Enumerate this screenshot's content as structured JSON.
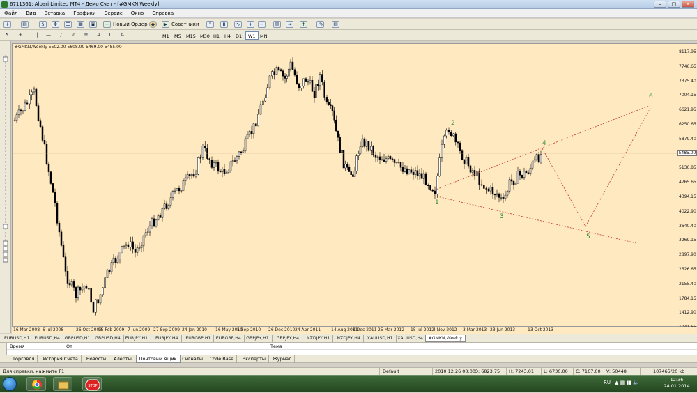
{
  "window": {
    "title": "6711361: Alpari Limited MT4 - Демо Счет - [#GMKN,Weekly]",
    "buttons": [
      "–",
      "□",
      "✕"
    ]
  },
  "menu": [
    "Файл",
    "Вид",
    "Вставка",
    "Графики",
    "Сервис",
    "Окно",
    "Справка"
  ],
  "toolbar": {
    "new_order": "Новый Ордер",
    "experts": "Советники"
  },
  "timeframes": [
    "M1",
    "M5",
    "M15",
    "M30",
    "H1",
    "H4",
    "D1",
    "W1",
    "MN"
  ],
  "active_timeframe": "W1",
  "chart": {
    "label": "#GMKN,Weekly  5502.00 5608.00 5469.00 5485.00",
    "current_price": "5485.00",
    "background": "#ffe9c0",
    "y_ticks": [
      "8117.95",
      "7746.65",
      "7375.40",
      "7004.15",
      "6621.95",
      "6250.65",
      "5879.40",
      "5485.00",
      "5136.85",
      "4765.65",
      "4394.15",
      "4022.90",
      "3640.40",
      "3269.15",
      "2897.90",
      "2526.65",
      "2155.40",
      "1784.15",
      "1412.90",
      "1041.65"
    ],
    "x_ticks": [
      "16 Mar 2008",
      "6 Jul 2008",
      "26 Oct 2008",
      "15 Feb 2009",
      "7 Jun 2009",
      "27 Sep 2009",
      "24 Jan 2010",
      "16 May 2010",
      "5 Sep 2010",
      "26 Dec 2010",
      "24 Apr 2011",
      "14 Aug 2011",
      "4 Dec 2011",
      "25 Mar 2012",
      "15 Jul 2012",
      "4 Nov 2012",
      "3 Mar 2013",
      "23 Jun 2013",
      "13 Oct 2013"
    ],
    "wave_labels": [
      "1",
      "2",
      "3",
      "4",
      "5",
      "6"
    ],
    "wave_color": "#2e8b2e",
    "trend_color": "#c0392b"
  },
  "symbol_tabs": [
    "EURUSD,H1",
    "EURUSD,H4",
    "GBPUSD,H1",
    "GBPUSD,H4",
    "EURJPY,H1",
    "EURJPY,H4",
    "EURGBP,H1",
    "EURGBP,H4",
    "GBPJPY,H1",
    "GBPJPY,H4",
    "NZDJPY,H1",
    "NZDJPY,H4",
    "XAUUSD,H1",
    "XAUUSD,H4",
    "#GMKN,Weekly"
  ],
  "active_symbol_tab": "#GMKN,Weekly",
  "terminal": {
    "col_time": "Время",
    "col_from": "От",
    "col_subject": "Тема",
    "side_label": "Терминал"
  },
  "terminal_tabs": [
    "Торговля",
    "История Счета",
    "Новости",
    "Алерты",
    "Почтовый ящик",
    "Сигналы",
    "Code Base",
    "Эксперты",
    "Журнал"
  ],
  "active_terminal_tab": "Почтовый ящик",
  "status": {
    "help": "Для справки, нажмите F1",
    "profile": "Default",
    "datetime": "2010.12.26 00:00",
    "open": "O: 6823.75",
    "high": "H: 7243.01",
    "low": "L: 6730.00",
    "close": "C: 7167.00",
    "volume": "V: 50448",
    "traffic": "107465/20 kb"
  },
  "taskbar": {
    "lang": "RU",
    "time": "12:36",
    "date": "24.01.2014",
    "stop_label": "STOP"
  }
}
